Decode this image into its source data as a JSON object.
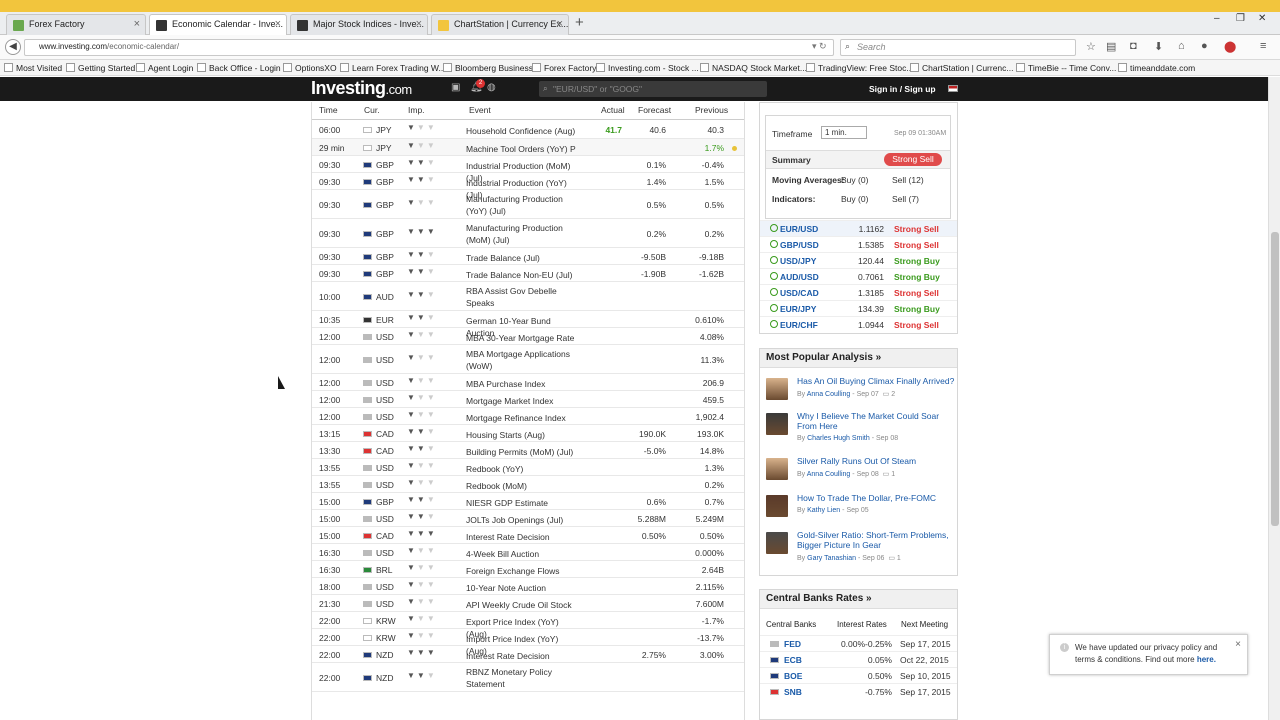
{
  "browser": {
    "tabs": [
      {
        "label": "Forex Factory",
        "color": "#6aa84f"
      },
      {
        "label": "Economic Calendar - Inve...",
        "color": "#333"
      },
      {
        "label": "Major Stock Indices - Inve...",
        "color": "#333"
      },
      {
        "label": "ChartStation | Currency Ex...",
        "color": "#f2c53d"
      }
    ],
    "new_tab": "+",
    "url_host": "www.investing.com",
    "url_path": "/economic-calendar/",
    "search_placeholder": "Search",
    "bookmarks": [
      "Most Visited",
      "Getting Started",
      "Agent Login",
      "Back Office - Login",
      "OptionsXO",
      "Learn Forex Trading W...",
      "Bloomberg Business",
      "Forex Factory",
      "Investing.com - Stock ...",
      "NASDAQ Stock Market...",
      "TradingView: Free Stoc...",
      "ChartStation | Currenc...",
      "TimeBie -- Time Conv...",
      "timeanddate.com"
    ]
  },
  "site": {
    "logo": "Investing",
    "logo_suffix": ".com",
    "bell_count": "2",
    "search_placeholder": "\"EUR/USD\" or \"GOOG\"",
    "signin": "Sign in / Sign up"
  },
  "calendar": {
    "headers": {
      "time": "Time",
      "cur": "Cur.",
      "imp": "Imp.",
      "event": "Event",
      "actual": "Actual",
      "forecast": "Forecast",
      "previous": "Previous"
    },
    "rows": [
      {
        "time": "06:00",
        "cur": "JPY",
        "imp": 1,
        "event": "Household Confidence (Aug)",
        "actual": "41.7",
        "forecast": "40.6",
        "previous": "40.3"
      },
      {
        "time": "29 min",
        "cur": "JPY",
        "imp": 1,
        "event": "Machine Tool Orders (YoY)  P",
        "actual": "",
        "forecast": "",
        "previous": "1.7%"
      },
      {
        "time": "09:30",
        "cur": "GBP",
        "imp": 2,
        "event": "Industrial Production (MoM) (Jul)",
        "actual": "",
        "forecast": "0.1%",
        "previous": "-0.4%"
      },
      {
        "time": "09:30",
        "cur": "GBP",
        "imp": 2,
        "event": "Industrial Production (YoY) (Jul)",
        "actual": "",
        "forecast": "1.4%",
        "previous": "1.5%"
      },
      {
        "time": "09:30",
        "cur": "GBP",
        "imp": 1,
        "event": "Manufacturing Production (YoY) (Jul)",
        "actual": "",
        "forecast": "0.5%",
        "previous": "0.5%"
      },
      {
        "time": "09:30",
        "cur": "GBP",
        "imp": 3,
        "event": "Manufacturing Production (MoM) (Jul)",
        "actual": "",
        "forecast": "0.2%",
        "previous": "0.2%"
      },
      {
        "time": "09:30",
        "cur": "GBP",
        "imp": 2,
        "event": "Trade Balance (Jul)",
        "actual": "",
        "forecast": "-9.50B",
        "previous": "-9.18B"
      },
      {
        "time": "09:30",
        "cur": "GBP",
        "imp": 2,
        "event": "Trade Balance Non-EU (Jul)",
        "actual": "",
        "forecast": "-1.90B",
        "previous": "-1.62B"
      },
      {
        "time": "10:00",
        "cur": "AUD",
        "imp": 2,
        "event": "RBA Assist Gov Debelle Speaks",
        "actual": "",
        "forecast": "",
        "previous": ""
      },
      {
        "time": "10:35",
        "cur": "EUR",
        "imp": 2,
        "event": "German 10-Year Bund Auction",
        "actual": "",
        "forecast": "",
        "previous": "0.610%"
      },
      {
        "time": "12:00",
        "cur": "USD",
        "imp": 1,
        "event": "MBA 30-Year Mortgage Rate",
        "actual": "",
        "forecast": "",
        "previous": "4.08%"
      },
      {
        "time": "12:00",
        "cur": "USD",
        "imp": 1,
        "event": "MBA Mortgage Applications (WoW)",
        "actual": "",
        "forecast": "",
        "previous": "11.3%"
      },
      {
        "time": "12:00",
        "cur": "USD",
        "imp": 1,
        "event": "MBA Purchase Index",
        "actual": "",
        "forecast": "",
        "previous": "206.9"
      },
      {
        "time": "12:00",
        "cur": "USD",
        "imp": 1,
        "event": "Mortgage Market Index",
        "actual": "",
        "forecast": "",
        "previous": "459.5"
      },
      {
        "time": "12:00",
        "cur": "USD",
        "imp": 1,
        "event": "Mortgage Refinance Index",
        "actual": "",
        "forecast": "",
        "previous": "1,902.4"
      },
      {
        "time": "13:15",
        "cur": "CAD",
        "imp": 2,
        "event": "Housing Starts (Aug)",
        "actual": "",
        "forecast": "190.0K",
        "previous": "193.0K"
      },
      {
        "time": "13:30",
        "cur": "CAD",
        "imp": 2,
        "event": "Building Permits (MoM) (Jul)",
        "actual": "",
        "forecast": "-5.0%",
        "previous": "14.8%"
      },
      {
        "time": "13:55",
        "cur": "USD",
        "imp": 1,
        "event": "Redbook (YoY)",
        "actual": "",
        "forecast": "",
        "previous": "1.3%"
      },
      {
        "time": "13:55",
        "cur": "USD",
        "imp": 1,
        "event": "Redbook (MoM)",
        "actual": "",
        "forecast": "",
        "previous": "0.2%"
      },
      {
        "time": "15:00",
        "cur": "GBP",
        "imp": 2,
        "event": "NIESR GDP Estimate",
        "actual": "",
        "forecast": "0.6%",
        "previous": "0.7%"
      },
      {
        "time": "15:00",
        "cur": "USD",
        "imp": 2,
        "event": "JOLTs Job Openings (Jul)",
        "actual": "",
        "forecast": "5.288M",
        "previous": "5.249M"
      },
      {
        "time": "15:00",
        "cur": "CAD",
        "imp": 3,
        "event": "Interest Rate Decision",
        "actual": "",
        "forecast": "0.50%",
        "previous": "0.50%"
      },
      {
        "time": "16:30",
        "cur": "USD",
        "imp": 1,
        "event": "4-Week Bill Auction",
        "actual": "",
        "forecast": "",
        "previous": "0.000%"
      },
      {
        "time": "16:30",
        "cur": "BRL",
        "imp": 1,
        "event": "Foreign Exchange Flows",
        "actual": "",
        "forecast": "",
        "previous": "2.64B"
      },
      {
        "time": "18:00",
        "cur": "USD",
        "imp": 1,
        "event": "10-Year Note Auction",
        "actual": "",
        "forecast": "",
        "previous": "2.115%"
      },
      {
        "time": "21:30",
        "cur": "USD",
        "imp": 1,
        "event": "API Weekly Crude Oil Stock",
        "actual": "",
        "forecast": "",
        "previous": "7.600M"
      },
      {
        "time": "22:00",
        "cur": "KRW",
        "imp": 1,
        "event": "Export Price Index (YoY) (Aug)",
        "actual": "",
        "forecast": "",
        "previous": "-1.7%"
      },
      {
        "time": "22:00",
        "cur": "KRW",
        "imp": 1,
        "event": "Import Price Index (YoY) (Aug)",
        "actual": "",
        "forecast": "",
        "previous": "-13.7%"
      },
      {
        "time": "22:00",
        "cur": "NZD",
        "imp": 3,
        "event": "Interest Rate Decision",
        "actual": "",
        "forecast": "2.75%",
        "previous": "3.00%"
      },
      {
        "time": "22:00",
        "cur": "NZD",
        "imp": 2,
        "event": "RBNZ Monetary Policy Statement",
        "actual": "",
        "forecast": "",
        "previous": ""
      }
    ]
  },
  "technical": {
    "timeframe_label": "Timeframe",
    "timeframe_value": "1 min.",
    "date": "Sep 09 01:30AM",
    "summary_label": "Summary",
    "summary_value": "Strong Sell",
    "ma_label": "Moving Averages:",
    "ma_buy": "Buy (0)",
    "ma_sell": "Sell (12)",
    "ind_label": "Indicators:",
    "ind_buy": "Buy (0)",
    "ind_sell": "Sell (7)",
    "pairs": [
      {
        "name": "EUR/USD",
        "value": "1.1162",
        "signal": "Strong Sell"
      },
      {
        "name": "GBP/USD",
        "value": "1.5385",
        "signal": "Strong Sell"
      },
      {
        "name": "USD/JPY",
        "value": "120.44",
        "signal": "Strong Buy"
      },
      {
        "name": "AUD/USD",
        "value": "0.7061",
        "signal": "Strong Buy"
      },
      {
        "name": "USD/CAD",
        "value": "1.3185",
        "signal": "Strong Sell"
      },
      {
        "name": "EUR/JPY",
        "value": "134.39",
        "signal": "Strong Buy"
      },
      {
        "name": "EUR/CHF",
        "value": "1.0944",
        "signal": "Strong Sell"
      }
    ]
  },
  "popular": {
    "title": "Most Popular Analysis »",
    "articles": [
      {
        "title": "Has An Oil Buying Climax Finally Arrived?",
        "author": "Anna Coulling",
        "date": "Sep 07",
        "comments": "2"
      },
      {
        "title": "Why I Believe The Market Could Soar From Here",
        "author": "Charles Hugh Smith",
        "date": "Sep 08",
        "comments": ""
      },
      {
        "title": "Silver Rally Runs Out Of Steam",
        "author": "Anna Coulling",
        "date": "Sep 08",
        "comments": "1"
      },
      {
        "title": "How To Trade The Dollar, Pre-FOMC",
        "author": "Kathy Lien",
        "date": "Sep 05",
        "comments": ""
      },
      {
        "title": "Gold-Silver Ratio: Short-Term Problems, Bigger Picture In Gear",
        "author": "Gary Tanashian",
        "date": "Sep 06",
        "comments": "1"
      }
    ]
  },
  "central_banks": {
    "title": "Central Banks Rates »",
    "headers": {
      "bank": "Central Banks",
      "rate": "Interest Rates",
      "next": "Next Meeting"
    },
    "rows": [
      {
        "bank": "FED",
        "rate": "0.00%-0.25%",
        "next": "Sep 17, 2015"
      },
      {
        "bank": "ECB",
        "rate": "0.05%",
        "next": "Oct 22, 2015"
      },
      {
        "bank": "BOE",
        "rate": "0.50%",
        "next": "Sep 10, 2015"
      },
      {
        "bank": "SNB",
        "rate": "-0.75%",
        "next": "Sep 17, 2015"
      }
    ]
  },
  "privacy": {
    "text": "We have updated our privacy policy and terms & conditions. Find out more",
    "link": "here."
  }
}
